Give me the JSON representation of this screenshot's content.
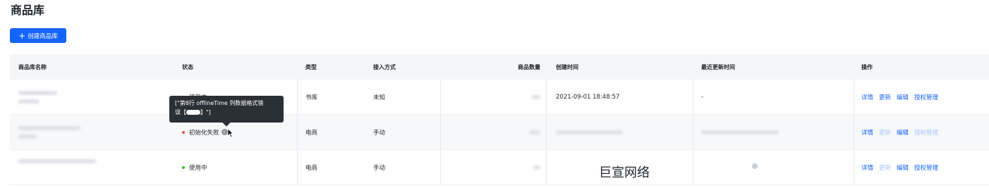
{
  "page": {
    "title": "商品库"
  },
  "toolbar": {
    "create_label": "创建商品库",
    "create_icon": "plus-icon"
  },
  "table": {
    "columns": [
      "商品库名称",
      "状态",
      "类型",
      "接入方式",
      "商品数量",
      "创建时间",
      "最近更新时间",
      "操作"
    ],
    "rows": [
      {
        "status": "使用中",
        "status_color": "#34c724",
        "type": "书库",
        "access": "未知",
        "created": "2021-09-01 18:48:57",
        "updated": "-",
        "ops": [
          "详情",
          "更新",
          "编辑",
          "授权管理"
        ]
      },
      {
        "status": "初始化失败",
        "status_color": "#f54a45",
        "type": "电商",
        "access": "手动",
        "created": "",
        "updated": "",
        "ops": [
          "详情",
          "更新",
          "编辑",
          "授权管理"
        ]
      },
      {
        "status": "使用中",
        "status_color": "#34c724",
        "type": "电商",
        "access": "手动",
        "created": "",
        "updated": "",
        "ops": [
          "详情",
          "更新",
          "编辑",
          "授权管理"
        ]
      }
    ]
  },
  "tooltip": {
    "line1": "[\"第8行 offlineTime 列数据格式错",
    "line2_prefix": "误【",
    "line2_suffix": "】\"]"
  },
  "watermark": "巨宣网络",
  "colors": {
    "primary": "#1664ff",
    "success": "#34c724",
    "danger": "#f54a45",
    "tooltip_bg": "#2b2f36"
  }
}
